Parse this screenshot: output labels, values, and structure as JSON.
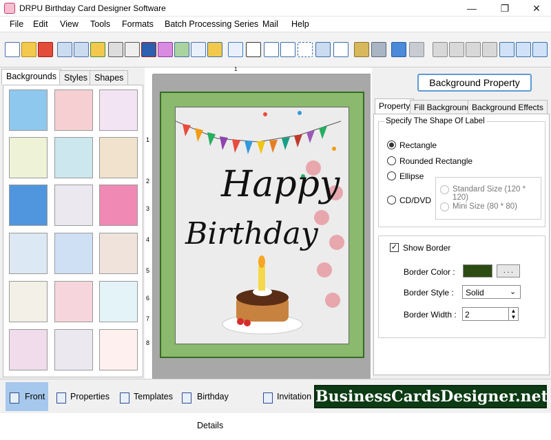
{
  "window": {
    "title": "DRPU Birthday Card Designer Software",
    "controls": {
      "minimize": "—",
      "maximize": "❐",
      "close": "✕"
    }
  },
  "menu": [
    "File",
    "Edit",
    "View",
    "Tools",
    "Formats",
    "Batch Processing Series",
    "Mail",
    "Help"
  ],
  "toolbar_icons": [
    "new-icon",
    "open-icon",
    "close-icon",
    "save-icon",
    "save-as-icon",
    "export-icon",
    "print-icon",
    "print-preview-icon",
    "color-icon",
    "image-icon",
    "picture-icon",
    "pen-icon",
    "shape-icon",
    "wordart-icon",
    "barcode-icon",
    "text-icon",
    "paragraph-icon",
    "signature-icon",
    "email-icon",
    "line-icon",
    "database-icon",
    "database-settings-icon",
    "undo-icon",
    "redo-icon",
    "copy-icon",
    "paste-icon",
    "duplicate-icon",
    "delete-icon",
    "grid-icon",
    "actual-size-icon",
    "fit-window-icon"
  ],
  "left_panel": {
    "tabs": [
      "Backgrounds",
      "Styles",
      "Shapes"
    ],
    "active_tab": "Backgrounds",
    "thumbnail_colors": [
      "#8fc8ef",
      "#f6cfd3",
      "#f3e4f3",
      "#eef3d8",
      "#cde7ef",
      "#f0e2cc",
      "#4f96de",
      "#ece8f0",
      "#f08ab5",
      "#dce8f3",
      "#cfe0f5",
      "#f0e3dc",
      "#f3f0e8",
      "#f6d6dc",
      "#e4f3f8",
      "#f0dceb",
      "#ece8f0",
      "#ffffff"
    ]
  },
  "ruler": {
    "top_marks": "1",
    "left_marks": [
      "1",
      "2",
      "3",
      "4",
      "5",
      "6",
      "7",
      "8"
    ]
  },
  "card": {
    "line1": "Happy",
    "line2": "Birthday",
    "border_color": "#356b22",
    "background_color": "#8bb96d"
  },
  "right_panel": {
    "header_button": "Background Property",
    "tabs": [
      "Property",
      "Fill Background",
      "Background Effects"
    ],
    "active_tab": "Property",
    "shape_group_title": "Specify The Shape Of Label",
    "shapes": [
      {
        "label": "Rectangle",
        "selected": true
      },
      {
        "label": "Rounded Rectangle",
        "selected": false
      },
      {
        "label": "Ellipse",
        "selected": false
      },
      {
        "label": "CD/DVD",
        "selected": false
      }
    ],
    "cd_sizes": [
      {
        "label": "Standard Size (120 * 120)",
        "enabled": false
      },
      {
        "label": "Mini Size (80 * 80)",
        "enabled": false
      }
    ],
    "show_border_label": "Show Border",
    "show_border_checked": true,
    "border_color_label": "Border Color :",
    "border_color_value": "#2d4c14",
    "border_color_button": ". . .",
    "border_style_label": "Border Style :",
    "border_style_value": "Solid",
    "border_width_label": "Border Width :",
    "border_width_value": "2"
  },
  "bottom_tabs": [
    "Front",
    "Properties",
    "Templates",
    "Birthday Details",
    "Invitation"
  ],
  "active_bottom_tab": "Front",
  "brand": "BusinessCardsDesigner.net"
}
